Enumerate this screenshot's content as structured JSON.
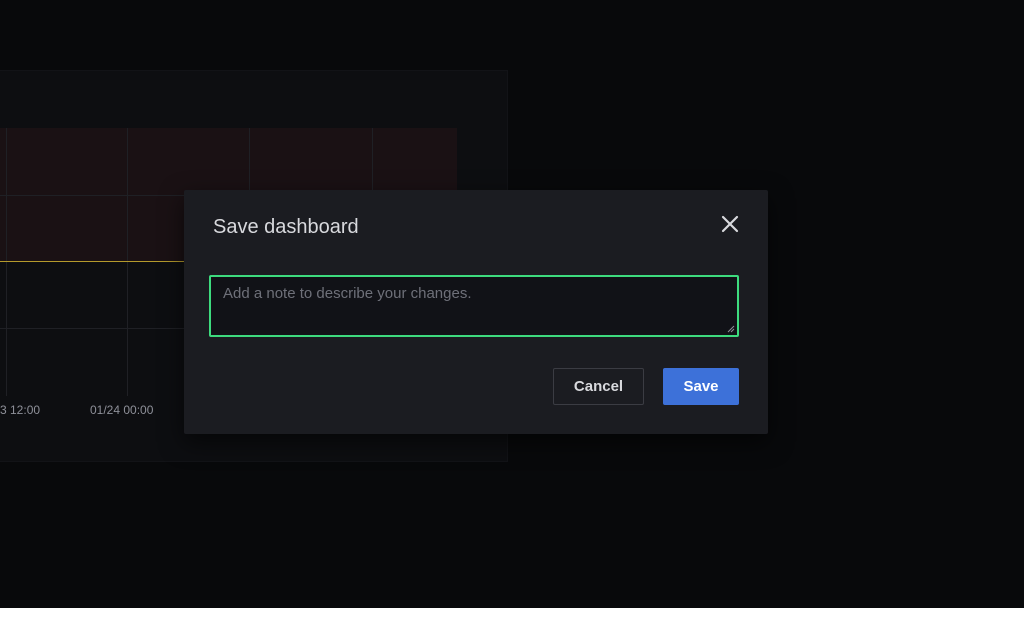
{
  "background_panel": {
    "x_axis_ticks": [
      "3 12:00",
      "01/24 00:00"
    ]
  },
  "modal": {
    "title": "Save dashboard",
    "close_icon": "close-icon",
    "note": {
      "value": "",
      "placeholder": "Add a note to describe your changes."
    },
    "cancel_label": "Cancel",
    "save_label": "Save"
  },
  "colors": {
    "focus_border": "#3ddb7e",
    "primary_button": "#3d71d9",
    "modal_background": "#1b1c21",
    "page_background": "#08090b",
    "threshold_line": "#b49a2c"
  }
}
